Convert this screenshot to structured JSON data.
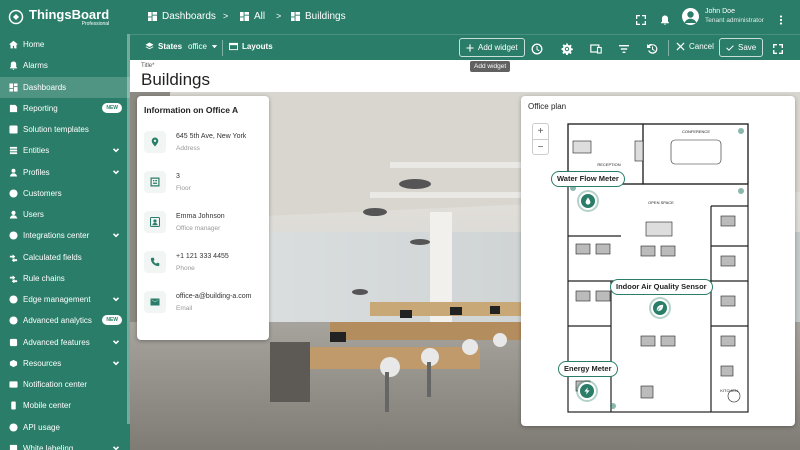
{
  "app": {
    "name": "ThingsBoard",
    "edition": "Professional"
  },
  "sidebar": {
    "items": [
      {
        "label": "Home",
        "icon": "home-icon",
        "chevron": false,
        "badge": ""
      },
      {
        "label": "Alarms",
        "icon": "alarm-icon",
        "chevron": false,
        "badge": ""
      },
      {
        "label": "Dashboards",
        "icon": "dashboards-icon",
        "chevron": false,
        "badge": "",
        "active": true
      },
      {
        "label": "Reporting",
        "icon": "reporting-icon",
        "chevron": false,
        "badge": "NEW"
      },
      {
        "label": "Solution templates",
        "icon": "solution-templates-icon",
        "chevron": false,
        "badge": ""
      },
      {
        "label": "Entities",
        "icon": "entities-icon",
        "chevron": true,
        "badge": ""
      },
      {
        "label": "Profiles",
        "icon": "profiles-icon",
        "chevron": true,
        "badge": ""
      },
      {
        "label": "Customers",
        "icon": "customers-icon",
        "chevron": false,
        "badge": ""
      },
      {
        "label": "Users",
        "icon": "users-icon",
        "chevron": false,
        "badge": ""
      },
      {
        "label": "Integrations center",
        "icon": "integrations-icon",
        "chevron": true,
        "badge": ""
      },
      {
        "label": "Calculated fields",
        "icon": "calculated-fields-icon",
        "chevron": false,
        "badge": ""
      },
      {
        "label": "Rule chains",
        "icon": "rule-chains-icon",
        "chevron": false,
        "badge": ""
      },
      {
        "label": "Edge management",
        "icon": "edge-icon",
        "chevron": true,
        "badge": ""
      },
      {
        "label": "Advanced analytics",
        "icon": "analytics-icon",
        "chevron": false,
        "badge": "NEW"
      },
      {
        "label": "Advanced features",
        "icon": "features-icon",
        "chevron": true,
        "badge": ""
      },
      {
        "label": "Resources",
        "icon": "resources-icon",
        "chevron": true,
        "badge": ""
      },
      {
        "label": "Notification center",
        "icon": "notification-center-icon",
        "chevron": false,
        "badge": ""
      },
      {
        "label": "Mobile center",
        "icon": "mobile-icon",
        "chevron": false,
        "badge": ""
      },
      {
        "label": "API usage",
        "icon": "api-usage-icon",
        "chevron": false,
        "badge": ""
      },
      {
        "label": "White labeling",
        "icon": "white-labeling-icon",
        "chevron": true,
        "badge": ""
      }
    ]
  },
  "header": {
    "breadcrumbs": [
      "Dashboards",
      "All",
      "Buildings"
    ],
    "separator": ">",
    "user": {
      "name": "John Doe",
      "role": "Tenant administrator"
    }
  },
  "toolbar": {
    "states_label": "States",
    "states_value": "office",
    "layouts_label": "Layouts",
    "add_widget_label": "Add widget",
    "cancel_label": "Cancel",
    "save_label": "Save"
  },
  "title": {
    "label": "Title",
    "value": "Buildings",
    "tooltip": "Add widget"
  },
  "info_card": {
    "title": "Information on Office A",
    "rows": [
      {
        "value": "645 5th Ave, New York",
        "label": "Address",
        "icon": "location-icon"
      },
      {
        "value": "3",
        "label": "Floor",
        "icon": "floor-icon"
      },
      {
        "value": "Emma Johnson",
        "label": "Office manager",
        "icon": "person-icon"
      },
      {
        "value": "+1 121 333 4455",
        "label": "Phone",
        "icon": "phone-icon"
      },
      {
        "value": "office-a@building-a.com",
        "label": "Email",
        "icon": "email-icon"
      }
    ]
  },
  "plan": {
    "title": "Office plan",
    "zoom_in": "+",
    "zoom_out": "−",
    "rooms": {
      "conference": "CONFERENCE",
      "reception": "RECEPTION",
      "open_space": "OPEN SPACE",
      "kitchen": "KITCHEN"
    },
    "sensors": [
      {
        "label": "Water Flow Meter",
        "icon": "water-drop-icon"
      },
      {
        "label": "Indoor Air Quality Sensor",
        "icon": "leaf-icon"
      },
      {
        "label": "Energy Meter",
        "icon": "energy-icon"
      }
    ]
  },
  "colors": {
    "primary": "#2a7d68",
    "surface": "#ffffff"
  }
}
